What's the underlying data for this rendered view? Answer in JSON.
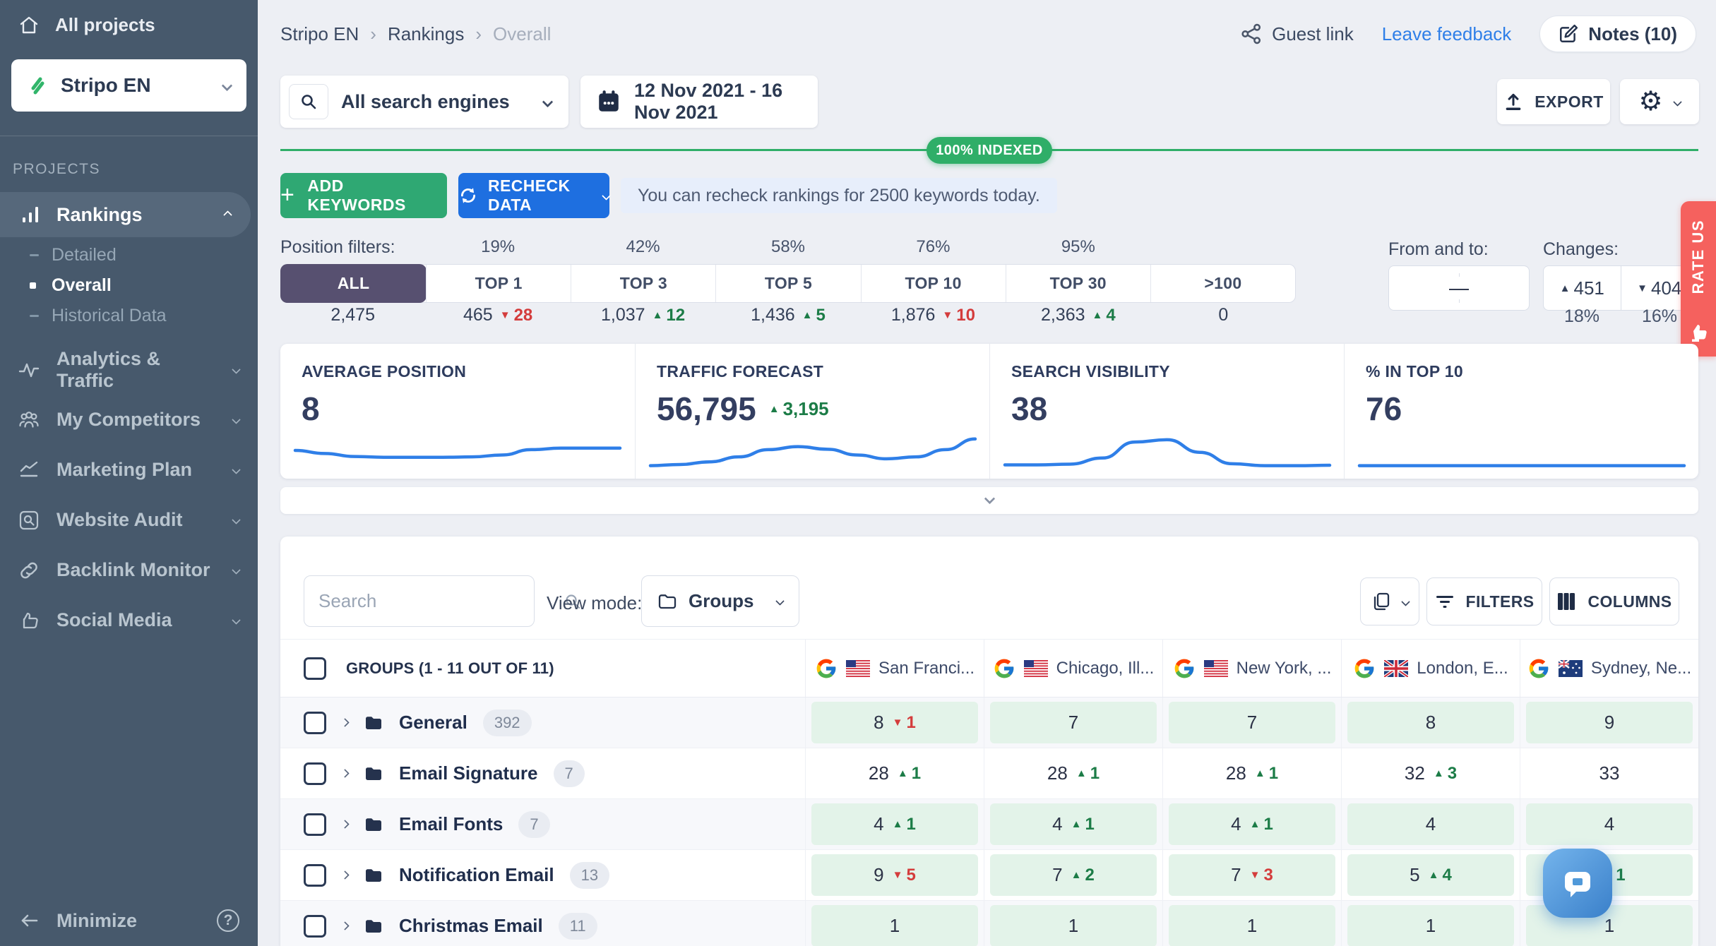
{
  "sidebar": {
    "all_projects": "All projects",
    "project": "Stripo EN",
    "projects_label": "PROJECTS",
    "rankings": "Rankings",
    "sub": [
      "Detailed",
      "Overall",
      "Historical Data"
    ],
    "items": [
      "Analytics & Traffic",
      "My Competitors",
      "Marketing Plan",
      "Website Audit",
      "Backlink Monitor",
      "Social Media"
    ],
    "minimize": "Minimize"
  },
  "icons": {
    "gear": "⚙",
    "help": "?"
  },
  "header": {
    "breadcrumb": [
      "Stripo EN",
      "Rankings",
      "Overall"
    ],
    "guest_link": "Guest link",
    "leave_feedback": "Leave feedback",
    "notes": "Notes (10)"
  },
  "toolbar": {
    "search_engines": "All search engines",
    "date_range": "12 Nov 2021 - 16 Nov 2021",
    "export": "EXPORT",
    "indexed": "100% INDEXED",
    "add_keywords": "ADD KEYWORDS",
    "recheck": "RECHECK DATA",
    "recheck_info": "You can recheck rankings for 2500 keywords today."
  },
  "filters": {
    "label": "Position filters:",
    "tabs": [
      {
        "label": "ALL",
        "percent": "",
        "count": "2,475"
      },
      {
        "label": "TOP 1",
        "percent": "19%",
        "count": "465",
        "dir": "down",
        "delta": "28"
      },
      {
        "label": "TOP 3",
        "percent": "42%",
        "count": "1,037",
        "dir": "up",
        "delta": "12"
      },
      {
        "label": "TOP 5",
        "percent": "58%",
        "count": "1,436",
        "dir": "up",
        "delta": "5"
      },
      {
        "label": "TOP 10",
        "percent": "76%",
        "count": "1,876",
        "dir": "down",
        "delta": "10"
      },
      {
        "label": "TOP 30",
        "percent": "95%",
        "count": "2,363",
        "dir": "up",
        "delta": "4"
      },
      {
        "label": ">100",
        "percent": "",
        "count": "0"
      }
    ],
    "from_to_label": "From and to:",
    "from_to_value": "—",
    "changes_label": "Changes:",
    "changes": {
      "up": "451",
      "down": "404",
      "up_pct": "18%",
      "down_pct": "16%"
    }
  },
  "cards": [
    {
      "title": "AVERAGE POSITION",
      "value": "8",
      "spark": [
        0.5,
        0.42,
        0.34,
        0.32,
        0.32,
        0.32,
        0.33,
        0.38,
        0.52,
        0.56,
        0.56,
        0.56
      ]
    },
    {
      "title": "TRAFFIC FORECAST",
      "value": "56,795",
      "dir": "up",
      "delta": "3,195",
      "spark": [
        0.1,
        0.13,
        0.2,
        0.33,
        0.52,
        0.6,
        0.53,
        0.38,
        0.28,
        0.33,
        0.52,
        0.8
      ]
    },
    {
      "title": "SEARCH VISIBILITY",
      "value": "38",
      "spark": [
        0.12,
        0.12,
        0.14,
        0.3,
        0.72,
        0.78,
        0.45,
        0.15,
        0.1,
        0.1,
        0.11
      ]
    },
    {
      "title": "% IN TOP 10",
      "value": "76",
      "spark": [
        0.1,
        0.1,
        0.1,
        0.1,
        0.1,
        0.1,
        0.1,
        0.1
      ]
    }
  ],
  "table": {
    "search_placeholder": "Search",
    "view_mode_label": "View mode:",
    "view_mode": "Groups",
    "filters_btn": "FILTERS",
    "columns_btn": "COLUMNS",
    "header": "GROUPS (1 - 11 OUT OF 11)",
    "columns": [
      {
        "name": "San Franci...",
        "flag": "us"
      },
      {
        "name": "Chicago, Ill...",
        "flag": "us"
      },
      {
        "name": "New York, ...",
        "flag": "us"
      },
      {
        "name": "London, E...",
        "flag": "gb"
      },
      {
        "name": "Sydney, Ne...",
        "flag": "au"
      }
    ],
    "rows": [
      {
        "name": "General",
        "count": "392",
        "cells": [
          {
            "v": "8",
            "dir": "down",
            "d": "1",
            "hl": "on"
          },
          {
            "v": "7",
            "hl": "on"
          },
          {
            "v": "7",
            "hl": "on"
          },
          {
            "v": "8",
            "hl": "on"
          },
          {
            "v": "9",
            "hl": "on"
          }
        ]
      },
      {
        "name": "Email Signature",
        "count": "7",
        "cells": [
          {
            "v": "28",
            "dir": "up",
            "d": "1",
            "hl": "off"
          },
          {
            "v": "28",
            "dir": "up",
            "d": "1",
            "hl": "off"
          },
          {
            "v": "28",
            "dir": "up",
            "d": "1",
            "hl": "off"
          },
          {
            "v": "32",
            "dir": "up",
            "d": "3",
            "hl": "off"
          },
          {
            "v": "33",
            "hl": "off"
          }
        ]
      },
      {
        "name": "Email Fonts",
        "count": "7",
        "cells": [
          {
            "v": "4",
            "dir": "up",
            "d": "1",
            "hl": "on"
          },
          {
            "v": "4",
            "dir": "up",
            "d": "1",
            "hl": "on"
          },
          {
            "v": "4",
            "dir": "up",
            "d": "1",
            "hl": "on"
          },
          {
            "v": "4",
            "hl": "on"
          },
          {
            "v": "4",
            "hl": "on"
          }
        ]
      },
      {
        "name": "Notification Email",
        "count": "13",
        "cells": [
          {
            "v": "9",
            "dir": "down",
            "d": "5",
            "hl": "on"
          },
          {
            "v": "7",
            "dir": "up",
            "d": "2",
            "hl": "on"
          },
          {
            "v": "7",
            "dir": "down",
            "d": "3",
            "hl": "on"
          },
          {
            "v": "5",
            "dir": "up",
            "d": "4",
            "hl": "on"
          },
          {
            "v": "",
            "dir": "up",
            "d": "1",
            "hl": "on"
          }
        ]
      },
      {
        "name": "Christmas Email",
        "count": "11",
        "cells": [
          {
            "v": "1",
            "hl": "on"
          },
          {
            "v": "1",
            "hl": "on"
          },
          {
            "v": "1",
            "hl": "on"
          },
          {
            "v": "1",
            "hl": "on"
          },
          {
            "v": "1",
            "hl": "on"
          }
        ]
      }
    ]
  },
  "rate_us": "RATE US",
  "colors": {
    "sidebar": "#47596c",
    "accent_green": "#2fa873",
    "primary_blue": "#1e6fe0",
    "selected_purple": "#575070",
    "indexed_green": "#2fae68",
    "ribbon_red": "#f5615e",
    "spark_blue": "#2f7fe8",
    "up_green": "#1c7c47",
    "down_red": "#d43c3c",
    "cell_green": "#e3f3e9",
    "link_blue": "#2f7fe8"
  }
}
